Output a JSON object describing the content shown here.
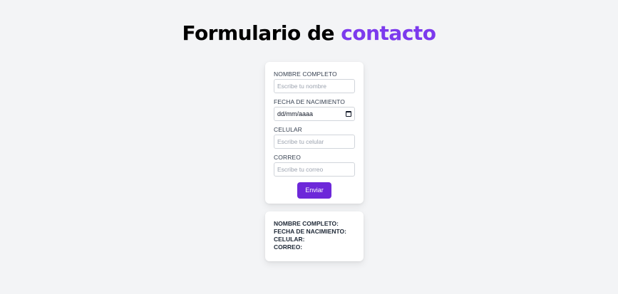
{
  "header": {
    "title_main": "Formulario de",
    "title_accent": "contacto",
    "accent_color": "#7c3aed"
  },
  "form": {
    "fields": [
      {
        "label": "NOMBRE COMPLETO",
        "placeholder": "Escribe tu nombre"
      },
      {
        "label": "FECHA DE NACIMIENTO",
        "value": "dd/mm/aaaa",
        "icon": "calendar-icon"
      },
      {
        "label": "CELULAR",
        "placeholder": "Escribe tu celular"
      },
      {
        "label": "CORREO",
        "placeholder": "Escribe tu correo"
      }
    ],
    "submit_label": "Enviar",
    "submit_color": "#6d28d9"
  },
  "result": {
    "lines": [
      "NOMBRE COMPLETO:",
      "FECHA DE NACIMIENTO:",
      "CELULAR:",
      "CORREO:"
    ]
  }
}
